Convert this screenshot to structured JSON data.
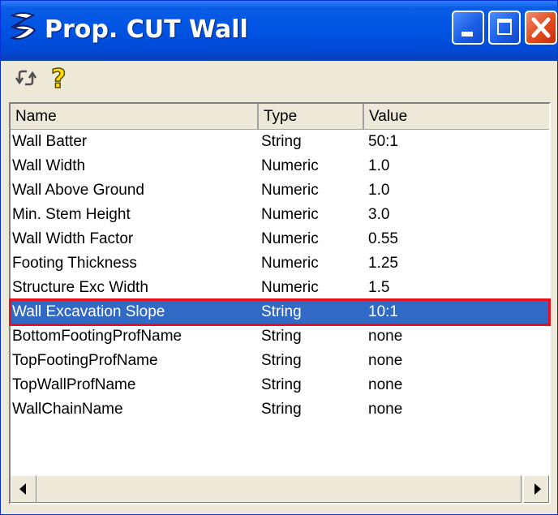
{
  "window": {
    "title": "Prop. CUT Wall",
    "icons": {
      "app": "app-logo-icon",
      "minimize": "minimize-icon",
      "maximize": "maximize-icon",
      "close": "close-icon"
    },
    "colors": {
      "titlebar": "#0054e3",
      "selection": "#316ac5",
      "highlight_box": "#e8101a",
      "face": "#ece9d8"
    }
  },
  "toolbar": {
    "icons": [
      "refresh-icon",
      "help-icon"
    ]
  },
  "table": {
    "columns": [
      "Name",
      "Type",
      "Value"
    ],
    "rows": [
      {
        "name": "Wall Batter",
        "type": "String",
        "value": "50:1"
      },
      {
        "name": "Wall Width",
        "type": "Numeric",
        "value": "1.0"
      },
      {
        "name": "Wall Above Ground",
        "type": "Numeric",
        "value": "1.0"
      },
      {
        "name": "Min. Stem Height",
        "type": "Numeric",
        "value": "3.0"
      },
      {
        "name": "Wall Width Factor",
        "type": "Numeric",
        "value": "0.55"
      },
      {
        "name": "Footing Thickness",
        "type": "Numeric",
        "value": "1.25"
      },
      {
        "name": "Structure Exc Width",
        "type": "Numeric",
        "value": "1.5"
      },
      {
        "name": "Wall Excavation Slope",
        "type": "String",
        "value": "10:1",
        "selected": true
      },
      {
        "name": "BottomFootingProfName",
        "type": "String",
        "value": "none"
      },
      {
        "name": "TopFootingProfName",
        "type": "String",
        "value": "none"
      },
      {
        "name": "TopWallProfName",
        "type": "String",
        "value": "none"
      },
      {
        "name": "WallChainName",
        "type": "String",
        "value": "none"
      }
    ]
  }
}
